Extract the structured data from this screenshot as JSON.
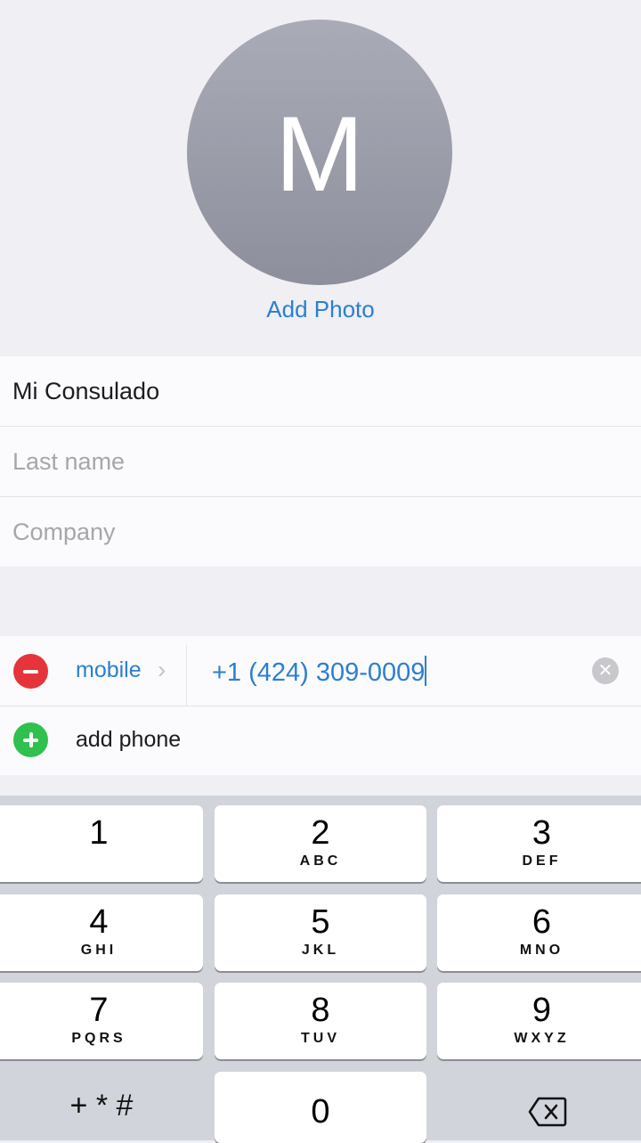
{
  "contact": {
    "initial": "M",
    "add_photo_label": "Add Photo",
    "first_name": "Mi Consulado",
    "last_name_placeholder": "Last name",
    "company_placeholder": "Company"
  },
  "phone": {
    "type_label": "mobile",
    "value": "+1 (424) 309-0009",
    "add_phone_label": "add phone"
  },
  "keypad": {
    "keys": [
      {
        "num": "1",
        "letters": ""
      },
      {
        "num": "2",
        "letters": "ABC"
      },
      {
        "num": "3",
        "letters": "DEF"
      },
      {
        "num": "4",
        "letters": "GHI"
      },
      {
        "num": "5",
        "letters": "JKL"
      },
      {
        "num": "6",
        "letters": "MNO"
      },
      {
        "num": "7",
        "letters": "PQRS"
      },
      {
        "num": "8",
        "letters": "TUV"
      },
      {
        "num": "9",
        "letters": "WXYZ"
      }
    ],
    "symbols_label": "+ * #",
    "zero": "0",
    "delete_icon": "backspace-icon"
  },
  "colors": {
    "accent": "#2c7fd0",
    "delete_red": "#e5353a",
    "add_green": "#2fc04d"
  }
}
